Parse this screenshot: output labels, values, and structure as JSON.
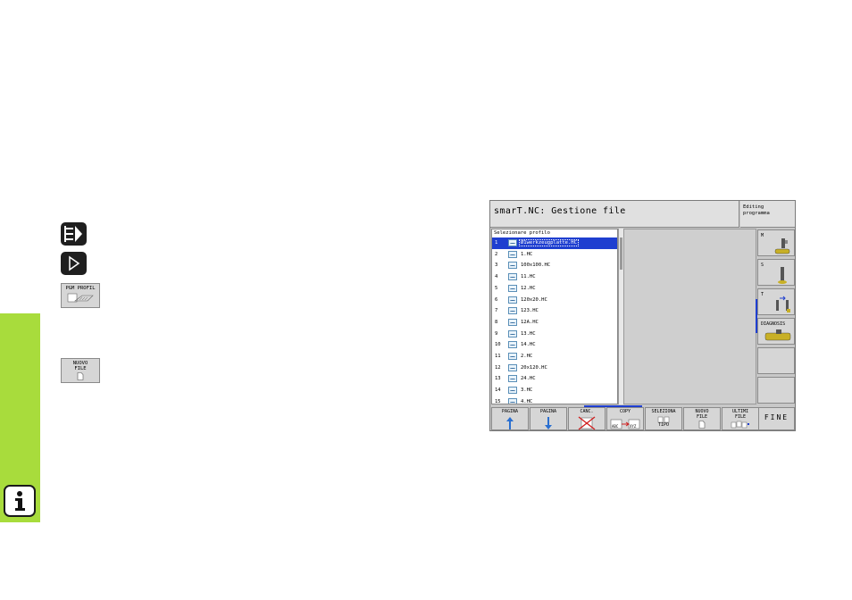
{
  "sidebar": {
    "info_icon": "info-icon",
    "color": "#a8dc3c"
  },
  "legend": {
    "keys": [
      {
        "icon": "program-edit-key-icon"
      },
      {
        "icon": "next-arrow-key-icon"
      }
    ],
    "soft_keys": [
      {
        "label_line1": "PGM PROFIL",
        "label_line2": ""
      },
      {
        "label_line1": "NUOVO",
        "label_line2": "FILE"
      }
    ]
  },
  "screen": {
    "title": "smarT.NC: Gestione file",
    "mode_line1": "Editing",
    "mode_line2": "programma",
    "list_header": "Selezionare profilo",
    "files": [
      {
        "num": "1",
        "name": "Ø1werkzeugplatte.HC"
      },
      {
        "num": "2",
        "name": "1.HC"
      },
      {
        "num": "3",
        "name": "100x100.HC"
      },
      {
        "num": "4",
        "name": "11.HC"
      },
      {
        "num": "5",
        "name": "12.HC"
      },
      {
        "num": "6",
        "name": "120x20.HC"
      },
      {
        "num": "7",
        "name": "123.HC"
      },
      {
        "num": "8",
        "name": "12A.HC"
      },
      {
        "num": "9",
        "name": "13.HC"
      },
      {
        "num": "10",
        "name": "14.HC"
      },
      {
        "num": "11",
        "name": "2.HC"
      },
      {
        "num": "12",
        "name": "20x120.HC"
      },
      {
        "num": "13",
        "name": "24.HC"
      },
      {
        "num": "14",
        "name": "3.HC"
      },
      {
        "num": "15",
        "name": "4.HC"
      }
    ],
    "selected_index": 0,
    "vertical_softkeys": [
      {
        "label": "M"
      },
      {
        "label": "S"
      },
      {
        "label": "T"
      },
      {
        "label": "DIAGNOSIS"
      },
      {
        "label": ""
      },
      {
        "label": ""
      }
    ],
    "horizontal_softkeys": [
      {
        "line1": "PAGINA",
        "line2": ""
      },
      {
        "line1": "PAGINA",
        "line2": ""
      },
      {
        "line1": "CANC.",
        "line2": ""
      },
      {
        "line1": "COPY",
        "line2": "",
        "sub1": "ABC",
        "sub2": "XYZ"
      },
      {
        "line1": "SELEZIONA",
        "line2": "TIPO"
      },
      {
        "line1": "NUOVO",
        "line2": "FILE"
      },
      {
        "line1": "ULTIMI",
        "line2": "FILE"
      },
      {
        "line1": "FINE",
        "line2": ""
      }
    ]
  }
}
